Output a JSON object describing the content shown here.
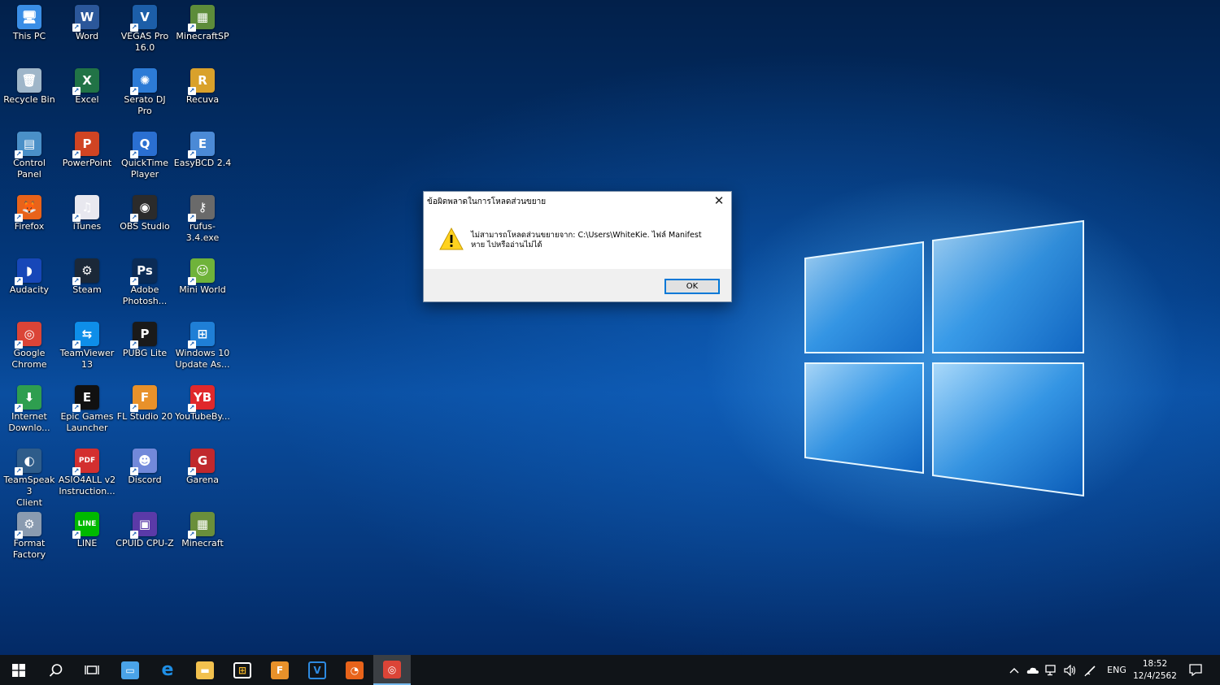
{
  "desktop": {
    "icons": [
      {
        "label": "This PC",
        "icon": "computer-icon",
        "color": "#3a8ee6",
        "glyph": "🖥"
      },
      {
        "label": "Word",
        "icon": "word-icon",
        "color": "#2b579a",
        "glyph": "W"
      },
      {
        "label": "VEGAS Pro\n16.0",
        "icon": "vegas-pro-icon",
        "color": "#1c5ea8",
        "glyph": "V"
      },
      {
        "label": "MinecraftSP",
        "icon": "minecraft-icon",
        "color": "#5d8c3a",
        "glyph": "▦"
      },
      {
        "label": "Recycle Bin",
        "icon": "recycle-bin-icon",
        "color": "#9fb6c9",
        "glyph": "🗑"
      },
      {
        "label": "Excel",
        "icon": "excel-icon",
        "color": "#217346",
        "glyph": "X"
      },
      {
        "label": "Serato DJ Pro",
        "icon": "serato-icon",
        "color": "#2c7bd6",
        "glyph": "✺"
      },
      {
        "label": "Recuva",
        "icon": "recuva-icon",
        "color": "#d9a12b",
        "glyph": "R"
      },
      {
        "label": "Control Panel",
        "icon": "control-panel-icon",
        "color": "#4a90c8",
        "glyph": "▤"
      },
      {
        "label": "PowerPoint",
        "icon": "powerpoint-icon",
        "color": "#d04423",
        "glyph": "P"
      },
      {
        "label": "QuickTime\nPlayer",
        "icon": "quicktime-icon",
        "color": "#2a6fd1",
        "glyph": "Q"
      },
      {
        "label": "EasyBCD 2.4",
        "icon": "easybcd-icon",
        "color": "#4b8ad6",
        "glyph": "E"
      },
      {
        "label": "Firefox",
        "icon": "firefox-icon",
        "color": "#e8631a",
        "glyph": "🦊"
      },
      {
        "label": "iTunes",
        "icon": "itunes-icon",
        "color": "#e8e8ef",
        "glyph": "♫"
      },
      {
        "label": "OBS Studio",
        "icon": "obs-icon",
        "color": "#2b2b2b",
        "glyph": "◉"
      },
      {
        "label": "rufus-3.4.exe",
        "icon": "rufus-icon",
        "color": "#6a6a6a",
        "glyph": "⚷"
      },
      {
        "label": "Audacity",
        "icon": "audacity-icon",
        "color": "#1747b8",
        "glyph": "◗"
      },
      {
        "label": "Steam",
        "icon": "steam-icon",
        "color": "#1b2838",
        "glyph": "⚙"
      },
      {
        "label": "Adobe\nPhotosh...",
        "icon": "photoshop-icon",
        "color": "#0b2b55",
        "glyph": "Ps"
      },
      {
        "label": "Mini World",
        "icon": "mini-world-icon",
        "color": "#6fb33a",
        "glyph": "☺"
      },
      {
        "label": "Google\nChrome",
        "icon": "chrome-icon",
        "color": "#db4437",
        "glyph": "◎"
      },
      {
        "label": "TeamViewer\n13",
        "icon": "teamviewer-icon",
        "color": "#0e8ee9",
        "glyph": "⇆"
      },
      {
        "label": "PUBG Lite",
        "icon": "pubg-icon",
        "color": "#1a1a1a",
        "glyph": "P"
      },
      {
        "label": "Windows 10\nUpdate As...",
        "icon": "windows-update-icon",
        "color": "#1f7fd6",
        "glyph": "⊞"
      },
      {
        "label": "Internet\nDownlo...",
        "icon": "idm-icon",
        "color": "#2e9e4f",
        "glyph": "⬇"
      },
      {
        "label": "Epic Games\nLauncher",
        "icon": "epic-games-icon",
        "color": "#111111",
        "glyph": "E"
      },
      {
        "label": "FL Studio 20",
        "icon": "fl-studio-icon",
        "color": "#e8912a",
        "glyph": "F"
      },
      {
        "label": "YouTubeBy...",
        "icon": "youtube-icon",
        "color": "#e0282b",
        "glyph": "YB"
      },
      {
        "label": "TeamSpeak 3\nClient",
        "icon": "teamspeak-icon",
        "color": "#2e5c8a",
        "glyph": "◐"
      },
      {
        "label": "ASIO4ALL v2\nInstruction...",
        "icon": "pdf-icon",
        "color": "#d32f2f",
        "glyph": "PDF"
      },
      {
        "label": "Discord",
        "icon": "discord-icon",
        "color": "#7289da",
        "glyph": "☻"
      },
      {
        "label": "Garena",
        "icon": "garena-icon",
        "color": "#c0282d",
        "glyph": "G"
      },
      {
        "label": "Format\nFactory",
        "icon": "format-factory-icon",
        "color": "#8a9bb0",
        "glyph": "⚙"
      },
      {
        "label": "LINE",
        "icon": "line-icon",
        "color": "#00b900",
        "glyph": "LINE"
      },
      {
        "label": "CPUID CPU-Z",
        "icon": "cpuz-icon",
        "color": "#5b3aa8",
        "glyph": "▣"
      },
      {
        "label": "Minecraft",
        "icon": "minecraft-icon",
        "color": "#6a8f3b",
        "glyph": "▦"
      }
    ]
  },
  "dialog": {
    "title": "ข้อผิดพลาดในการโหลดส่วนขยาย",
    "message": "ไม่สามารถโหลดส่วนขยายจาก: C:\\Users\\WhiteKie. ไฟล์ Manifest หาย ไปหรืออ่านไม่ได้",
    "ok_label": "OK"
  },
  "taskbar": {
    "apps": [
      {
        "name": "computer-management",
        "icon": "network-computer-icon",
        "color": "#4aa3e8",
        "glyph": "▭"
      },
      {
        "name": "edge",
        "icon": "edge-icon",
        "color": "#1f7fd6",
        "glyph": "e"
      },
      {
        "name": "file-explorer",
        "icon": "folder-icon",
        "color": "#f2c14e",
        "glyph": "▬"
      },
      {
        "name": "store",
        "icon": "store-icon",
        "color": "#ffffff",
        "glyph": "⊞"
      },
      {
        "name": "fl-studio",
        "icon": "fl-studio-icon",
        "color": "#e8912a",
        "glyph": "F"
      },
      {
        "name": "vegas",
        "icon": "vegas-pro-icon",
        "color": "#1c5ea8",
        "glyph": "V"
      },
      {
        "name": "firefox",
        "icon": "firefox-icon",
        "color": "#e8631a",
        "glyph": "◔"
      },
      {
        "name": "chrome",
        "icon": "chrome-icon",
        "color": "#db4437",
        "glyph": "◎"
      }
    ],
    "language": "ENG",
    "time": "18:52",
    "date": "12/4/2562"
  }
}
